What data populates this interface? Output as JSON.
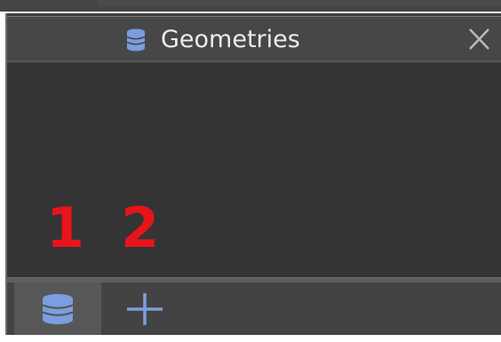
{
  "panel": {
    "title": "Geometries",
    "title_icon": "database-icon",
    "close_icon": "close-icon"
  },
  "annotations": [
    "1",
    "2"
  ],
  "bottom_tabs": [
    {
      "icon": "database-icon",
      "selected": true
    },
    {
      "icon": "plus-icon",
      "selected": false
    }
  ],
  "colors": {
    "panel_bg": "#343434",
    "title_bar_bg": "#474747",
    "icon_blue": "#7a9ee0",
    "annotation_red": "#e8141c",
    "title_text": "#ececec"
  }
}
